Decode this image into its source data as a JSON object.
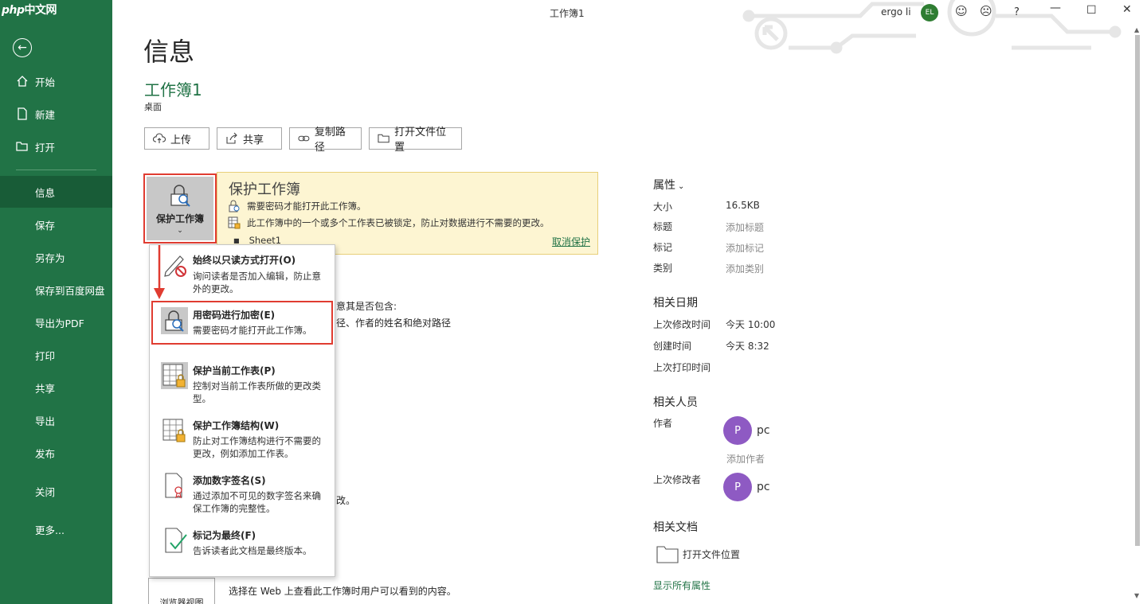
{
  "watermark": {
    "php": "php",
    "site": "中文网"
  },
  "window": {
    "title": "工作簿1",
    "user_name": "ergo li",
    "user_initials": "EL",
    "help": "?"
  },
  "sidebar": {
    "items": [
      {
        "label": "开始"
      },
      {
        "label": "新建"
      },
      {
        "label": "打开"
      },
      {
        "label": "信息"
      },
      {
        "label": "保存"
      },
      {
        "label": "另存为"
      },
      {
        "label": "保存到百度网盘"
      },
      {
        "label": "导出为PDF"
      },
      {
        "label": "打印"
      },
      {
        "label": "共享"
      },
      {
        "label": "导出"
      },
      {
        "label": "发布"
      },
      {
        "label": "关闭"
      },
      {
        "label": "更多..."
      }
    ]
  },
  "main": {
    "title": "信息",
    "workbook_name": "工作簿1",
    "location": "桌面",
    "actions": {
      "upload": "上传",
      "share": "共享",
      "copy_path": "复制路径",
      "open_location": "打开文件位置"
    }
  },
  "protect": {
    "button_label": "保护工作簿",
    "title": "保护工作簿",
    "line1": "需要密码才能打开此工作簿。",
    "line2": "此工作簿中的一个或多个工作表已被锁定，防止对数据进行不需要的更改。",
    "sheet": "Sheet1",
    "unprotect": "取消保护"
  },
  "menu": {
    "items": [
      {
        "title": "始终以只读方式打开(O)",
        "desc": "询问读者是否加入编辑，防止意外的更改。"
      },
      {
        "title": "用密码进行加密(E)",
        "desc": "需要密码才能打开此工作簿。"
      },
      {
        "title": "保护当前工作表(P)",
        "desc": "控制对当前工作表所做的更改类型。"
      },
      {
        "title": "保护工作簿结构(W)",
        "desc": "防止对工作簿结构进行不需要的更改，例如添加工作表。"
      },
      {
        "title": "添加数字签名(S)",
        "desc": "通过添加不可见的数字签名来确保工作簿的完整性。"
      },
      {
        "title": "标记为最终(F)",
        "desc": "告诉读者此文档是最终版本。"
      }
    ]
  },
  "background_text": {
    "inspect1": "意其是否包含:",
    "inspect2": "径、作者的姓名和绝对路径",
    "versions": "改。",
    "browser_view": "选择在 Web 上查看此工作簿时用户可以看到的内容。",
    "browser_view_btn": "浏览器视图"
  },
  "properties": {
    "heading": "属性",
    "size_label": "大小",
    "size_value": "16.5KB",
    "title_label": "标题",
    "title_value": "添加标题",
    "tags_label": "标记",
    "tags_value": "添加标记",
    "category_label": "类别",
    "category_value": "添加类别",
    "dates_heading": "相关日期",
    "modified_label": "上次修改时间",
    "modified_value": "今天 10:00",
    "created_label": "创建时间",
    "created_value": "今天 8:32",
    "printed_label": "上次打印时间",
    "people_heading": "相关人员",
    "author_label": "作者",
    "author_initial": "P",
    "author_name": "pc",
    "add_author": "添加作者",
    "last_modified_by_label": "上次修改者",
    "modifier_initial": "P",
    "modifier_name": "pc",
    "docs_heading": "相关文档",
    "open_folder": "打开文件位置",
    "show_all": "显示所有属性"
  }
}
